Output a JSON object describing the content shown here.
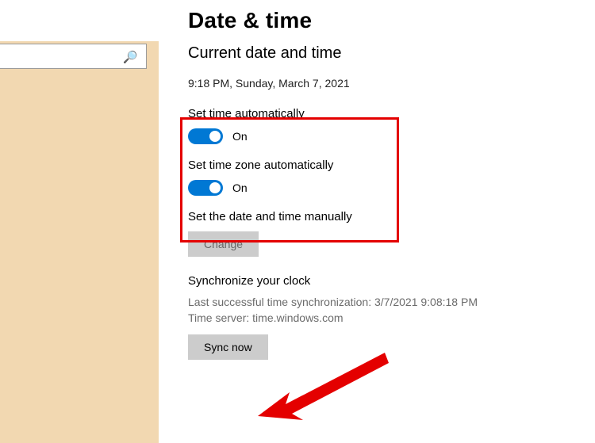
{
  "sidebar": {
    "search_placeholder": ""
  },
  "page": {
    "title": "Date & time",
    "section_heading": "Current date and time",
    "current_datetime": "9:18 PM, Sunday, March 7, 2021"
  },
  "toggles": {
    "set_time_auto": {
      "label": "Set time automatically",
      "state": "On"
    },
    "set_tz_auto": {
      "label": "Set time zone automatically",
      "state": "On"
    }
  },
  "manual": {
    "label": "Set the date and time manually",
    "button": "Change"
  },
  "sync": {
    "heading": "Synchronize your clock",
    "last_line": "Last successful time synchronization: 3/7/2021 9:08:18 PM",
    "server_line": "Time server: time.windows.com",
    "button": "Sync now"
  }
}
